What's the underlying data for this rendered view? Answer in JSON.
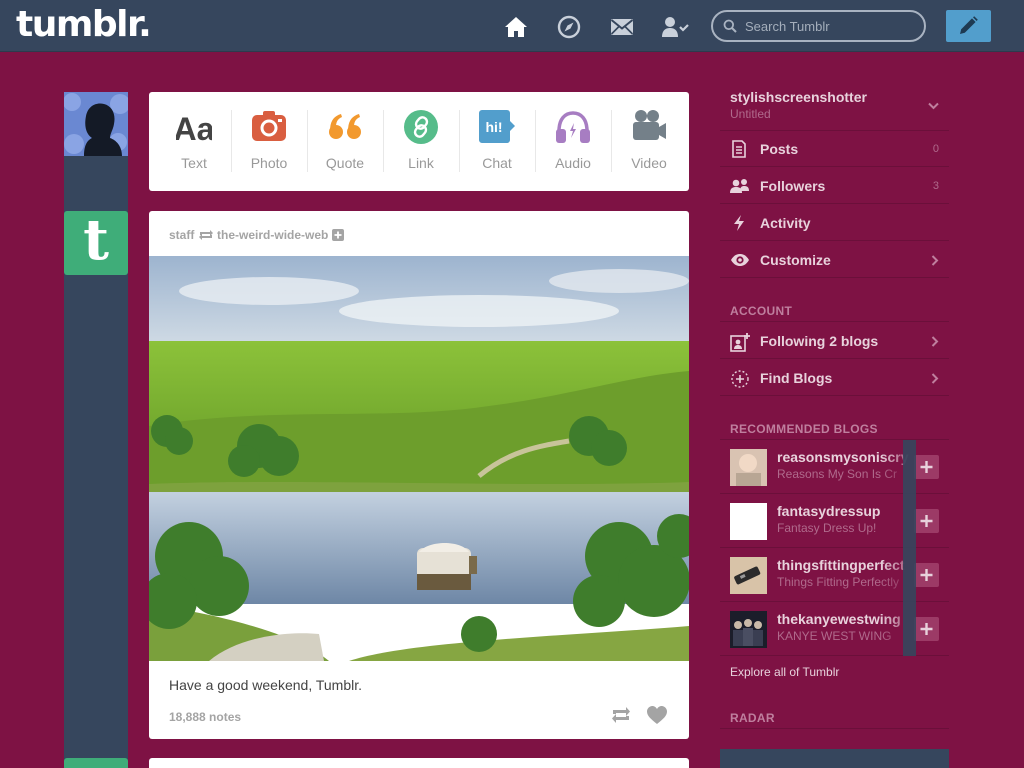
{
  "header": {
    "logo": "tumblr.",
    "search_placeholder": "Search Tumblr"
  },
  "post_types": [
    {
      "label": "Text",
      "icon": "text-icon",
      "color": "#444444"
    },
    {
      "label": "Photo",
      "icon": "camera-icon",
      "color": "#d95e40"
    },
    {
      "label": "Quote",
      "icon": "quote-icon",
      "color": "#f2992e"
    },
    {
      "label": "Link",
      "icon": "link-icon",
      "color": "#56bc8a"
    },
    {
      "label": "Chat",
      "icon": "chat-icon",
      "color": "#529ecc"
    },
    {
      "label": "Audio",
      "icon": "headphones-icon",
      "color": "#a77dc2"
    },
    {
      "label": "Video",
      "icon": "video-camera-icon",
      "color": "#748089"
    }
  ],
  "post": {
    "author": "staff",
    "reblogged_from": "the-weird-wide-web",
    "caption": "Have a good weekend, Tumblr.",
    "notes": "18,888 notes"
  },
  "sidebar": {
    "blog": {
      "name": "stylishscreenshotter",
      "title": "Untitled"
    },
    "items": [
      {
        "label": "Posts",
        "count": "0",
        "icon": "posts-icon"
      },
      {
        "label": "Followers",
        "count": "3",
        "icon": "followers-icon"
      },
      {
        "label": "Activity",
        "icon": "lightning-icon"
      },
      {
        "label": "Customize",
        "icon": "eye-icon"
      }
    ],
    "account_heading": "ACCOUNT",
    "account_items": [
      {
        "label": "Following 2 blogs",
        "icon": "following-icon"
      },
      {
        "label": "Find Blogs",
        "icon": "find-blogs-icon"
      }
    ],
    "recommended_heading": "RECOMMENDED BLOGS",
    "recommended": [
      {
        "name": "reasonsmysoniscry",
        "title": "Reasons My Son Is Cr"
      },
      {
        "name": "fantasydressup",
        "title": "Fantasy Dress Up!"
      },
      {
        "name": "thingsfittingperfect",
        "title": "Things Fitting Perfectly"
      },
      {
        "name": "thekanyewestwing",
        "title": "KANYE WEST WING"
      }
    ],
    "explore": "Explore all of Tumblr",
    "radar_heading": "RADAR"
  },
  "colors": {
    "header": "#36465d",
    "background": "#7e1244",
    "accent": "#529ecc",
    "staff": "#3fad79"
  }
}
